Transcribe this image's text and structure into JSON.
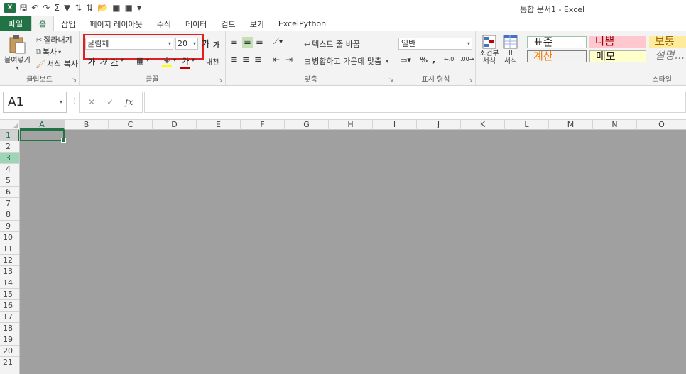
{
  "window": {
    "title": "통합 문서1 - Excel"
  },
  "qat": {
    "logo": "X",
    "save": "🖫",
    "undo": "↶",
    "redo": "↷",
    "autosum": "Σ",
    "filter": "▼",
    "sort_asc": "⇅",
    "sort_desc": "⇅",
    "open": "📂",
    "extra1": "▣",
    "extra2": "▣",
    "customize": "▾"
  },
  "tabs": [
    "파일",
    "홈",
    "삽입",
    "페이지 레이아웃",
    "수식",
    "데이터",
    "검토",
    "보기",
    "ExcelPython"
  ],
  "clipboard": {
    "paste": "붙여넣기",
    "cut": "잘라내기",
    "copy": "복사",
    "format_painter": "서식 복사",
    "label": "클립보드"
  },
  "font": {
    "name": "굴림체",
    "size": "20",
    "bold": "가",
    "italic": "가",
    "underline": "가",
    "grow": "가",
    "shrink": "가",
    "phonetic": "내천",
    "label": "글꼴",
    "font_color": "#c00000",
    "fill_color": "#ffff00"
  },
  "alignment": {
    "wrap_text": "텍스트 줄 바꿈",
    "merge_center": "병합하고 가운데 맞춤",
    "label": "맞춤"
  },
  "number": {
    "format": "일반",
    "percent": "%",
    "comma": ",",
    "label": "표시 형식"
  },
  "styles": {
    "conditional": "조건부\n서식",
    "as_table": "표\n서식",
    "normal": "표준",
    "bad": "나쁨",
    "neutral": "보통",
    "calc": "계산",
    "note": "메모",
    "explanatory": "설명...",
    "label": "스타일",
    "bad_bg": "#ffc7ce",
    "bad_fg": "#9c0006",
    "neutral_bg": "#ffeb9c",
    "neutral_fg": "#9c6500",
    "calc_fg": "#fa7d00",
    "note_bg": "#ffffcc"
  },
  "formula_bar": {
    "name_box": "A1",
    "cancel": "✕",
    "enter": "✓",
    "fx": "fx",
    "value": ""
  },
  "grid": {
    "columns": [
      "A",
      "B",
      "C",
      "D",
      "E",
      "F",
      "G",
      "H",
      "I",
      "J",
      "K",
      "L",
      "M",
      "N",
      "O"
    ],
    "rows": [
      "1",
      "2",
      "3",
      "4",
      "5",
      "6",
      "7",
      "8",
      "9",
      "10",
      "11",
      "12",
      "13",
      "14",
      "15",
      "16",
      "17",
      "18",
      "19",
      "20",
      "21"
    ],
    "selected_cell": "A1"
  }
}
